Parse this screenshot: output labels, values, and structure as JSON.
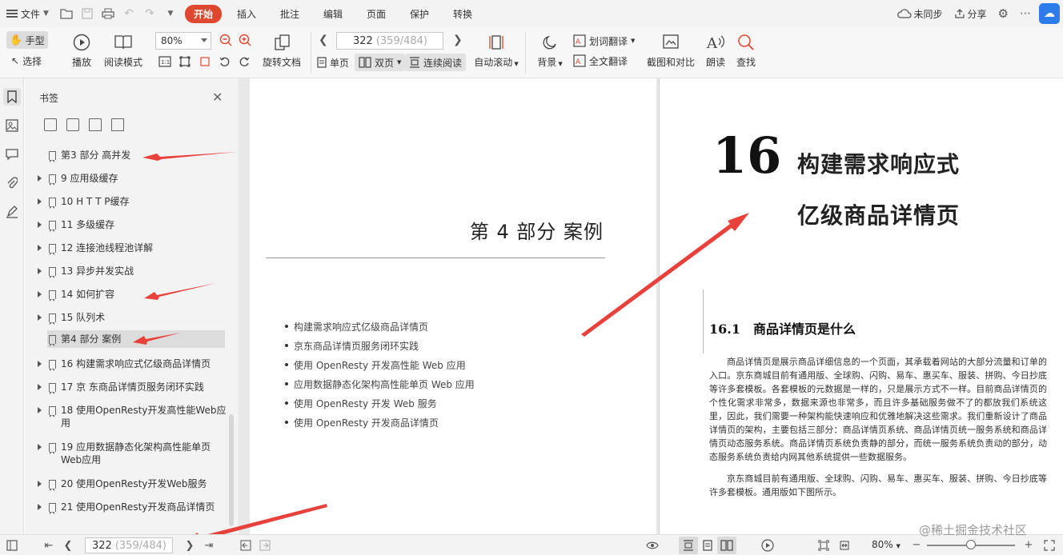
{
  "menubar": {
    "file_label": "文件",
    "tabs": [
      {
        "label": "开始",
        "active": true
      },
      {
        "label": "插入"
      },
      {
        "label": "批注"
      },
      {
        "label": "编辑"
      },
      {
        "label": "页面"
      },
      {
        "label": "保护"
      },
      {
        "label": "转换"
      }
    ],
    "sync_label": "未同步",
    "share_label": "分享",
    "accent_color": "#e0472f"
  },
  "toolbar": {
    "hand_label": "手型",
    "select_label": "选择",
    "play_label": "播放",
    "read_mode_label": "阅读模式",
    "zoom_value": "80%",
    "rotate_label": "旋转文档",
    "page_current": "322",
    "page_total": "(359/484)",
    "single_label": "单页",
    "double_label": "双页",
    "continuous_label": "连续阅读",
    "auto_scroll_label": "自动滚动",
    "background_label": "背景",
    "word_translate_label": "划词翻译",
    "full_translate_label": "全文翻译",
    "screenshot_label": "截图和对比",
    "read_aloud_label": "朗读",
    "find_label": "查找"
  },
  "bookmarks": {
    "title": "书签",
    "items": [
      {
        "label": "第3 部分  高并发",
        "expandable": false
      },
      {
        "label": "9 应用级缓存",
        "expandable": true
      },
      {
        "label": "10 H T T P缓存",
        "expandable": true
      },
      {
        "label": "11 多级缓存",
        "expandable": true
      },
      {
        "label": "12 连接池线程池详解",
        "expandable": true
      },
      {
        "label": "13 异步并发实战",
        "expandable": true
      },
      {
        "label": "14 如何扩容",
        "expandable": true
      },
      {
        "label": "15 队列术",
        "expandable": true
      },
      {
        "label": "第4 部分  案例",
        "expandable": false,
        "selected": true
      },
      {
        "label": "16 构建需求响应式亿级商品详情页",
        "expandable": true
      },
      {
        "label": "17 京 东商品详情页服务闭环实践",
        "expandable": true
      },
      {
        "label": "18 使用OpenResty开发高性能Web应用",
        "expandable": true
      },
      {
        "label": "19 应用数据静态化架构高性能单页Web应用",
        "expandable": true
      },
      {
        "label": "20 使用OpenResty开发Web服务",
        "expandable": true
      },
      {
        "label": "21 使用OpenResty开发商品详情页",
        "expandable": true
      }
    ]
  },
  "left_page": {
    "part_title": "第 4 部分    案例",
    "toc": [
      "构建需求响应式亿级商品详情页",
      "京东商品详情页服务闭环实践",
      "使用 OpenResty 开发高性能 Web 应用",
      "应用数据静态化架构高性能单页 Web 应用",
      "使用 OpenResty 开发 Web 服务",
      "使用 OpenResty 开发商品详情页"
    ]
  },
  "right_page": {
    "chapter_number": "16",
    "chapter_title_line1": "构建需求响应式",
    "chapter_title_line2": "亿级商品详情页",
    "section_number": "16.1",
    "section_title": "商品详情页是什么",
    "paragraph1": "商品详情页是展示商品详细信息的一个页面，其承载着网站的大部分流量和订单的入口。京东商城目前有通用版、全球购、闪购、易车、惠买车、服装、拼购、今日抄底等许多套模板。各套模板的元数据是一样的，只是展示方式不一样。目前商品详情页的个性化需求非常多，数据来源也非常多，而且许多基础服务做不了的都放我们系统这里，因此，我们需要一种架构能快速响应和优雅地解决这些需求。我们重新设计了商品详情页的架构，主要包括三部分：商品详情页系统、商品详情页统一服务系统和商品详情页动态服务系统。商品详情页系统负责静的部分，而统一服务系统负责动的部分，动态服务系统负责给内网其他系统提供一些数据服务。",
    "paragraph2": "京东商城目前有通用版、全球购、闪购、易车、惠买车、服装、拼购、今日抄底等许多套模板。通用版如下图所示。"
  },
  "statusbar": {
    "page_current": "322",
    "page_total": "(359/484)",
    "zoom_value": "80%"
  },
  "watermark": "@稀土掘金技术社区"
}
